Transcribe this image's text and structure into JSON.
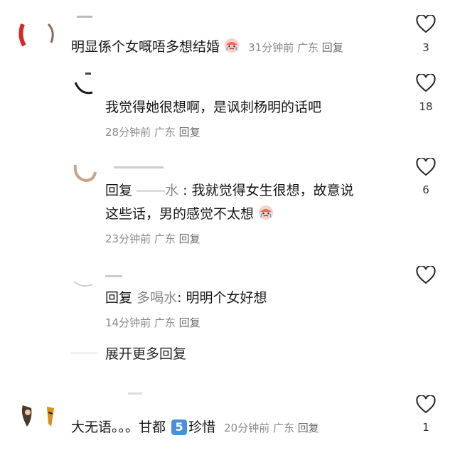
{
  "comments": [
    {
      "text": "明显係个女嘅唔多想结婚",
      "time": "31分钟前",
      "location": "广东",
      "reply_label": "回复",
      "likes": "3"
    },
    {
      "text": "我觉得她很想啊，是讽刺杨明的话吧",
      "time": "28分钟前",
      "location": "广东",
      "reply_label": "回复",
      "likes": "18"
    },
    {
      "reply_prefix": "回复",
      "reply_user": "水",
      "text_line1": ": 我就觉得女生很想，故意说",
      "text_line2": "这些话，男的感觉不太想",
      "time": "23分钟前",
      "location": "广东",
      "reply_label": "回复",
      "likes": "6"
    },
    {
      "reply_prefix": "回复",
      "reply_user": "多喝水",
      "text": ": 明明个女好想",
      "time": "14分钟前",
      "location": "广东",
      "reply_label": "回复",
      "likes": ""
    },
    {
      "text_before": "大无语。。。甘都",
      "badge": "5",
      "text_after": "珍惜",
      "time": "20分钟前",
      "location": "广东",
      "reply_label": "回复",
      "likes": "1"
    }
  ],
  "expand_label": "展开更多回复",
  "colors": {
    "heart_stroke": "#222222",
    "meta": "#8a8a8a",
    "badge": "#4a90d9"
  }
}
